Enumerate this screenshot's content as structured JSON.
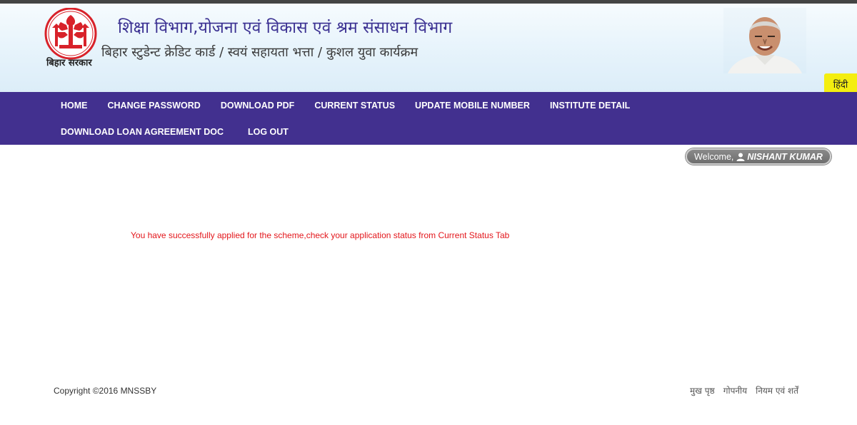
{
  "header": {
    "logo_caption": "बिहार सरकार",
    "title_main": "शिक्षा विभाग,योजना एवं विकास एवं श्रम संसाधन विभाग",
    "title_sub": "बिहार स्टुडेन्ट क्रेडिट कार्ड / स्वयं सहायता भत्ता / कुशल युवा कार्यक्रम",
    "language_button": "हिंदी",
    "logo_icon": "bihar-emblem-icon",
    "portrait_icon": "chief-minister-portrait",
    "accent_color": "#42308f",
    "lang_color": "#f4ee10"
  },
  "nav": {
    "row1": [
      "HOME",
      "CHANGE PASSWORD",
      "DOWNLOAD PDF",
      "CURRENT STATUS",
      "UPDATE MOBILE NUMBER",
      "INSTITUTE DETAIL"
    ],
    "row2": [
      "DOWNLOAD LOAN AGREEMENT DOC",
      "LOG OUT"
    ]
  },
  "user": {
    "welcome_label": "Welcome,",
    "name": "NISHANT KUMAR",
    "icon": "user-icon"
  },
  "main": {
    "message": "You have successfully applied for the scheme,check your application status from Current Status Tab",
    "message_color": "#e3161b"
  },
  "footer": {
    "copyright": "Copyright ©2016 MNSSBY",
    "links": [
      "मुख पृष्ठ",
      "गोपनीय",
      "नियम एवं शर्तें"
    ]
  }
}
